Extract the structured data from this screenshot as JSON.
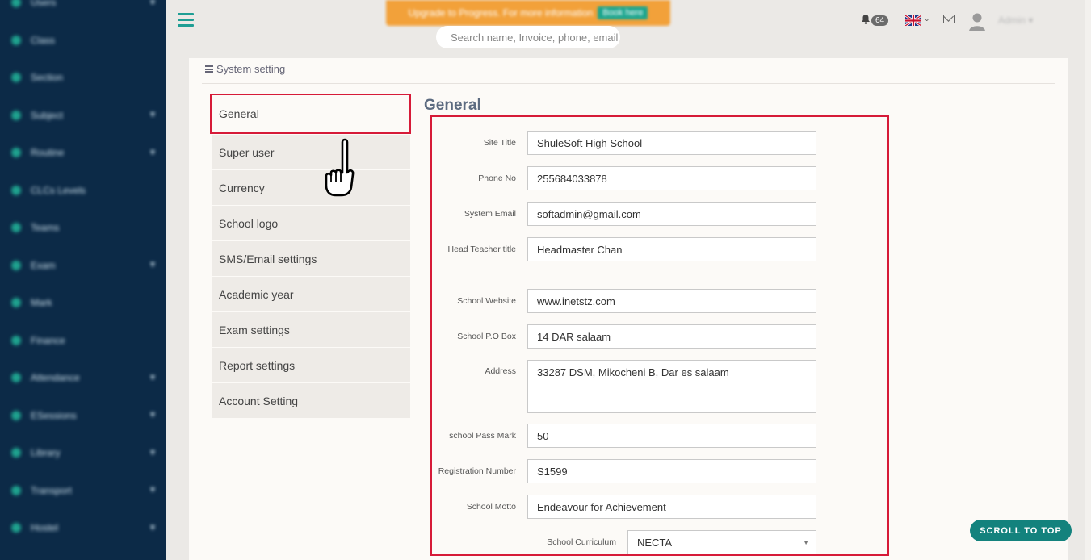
{
  "topbar": {
    "promo_text": "Upgrade to Progress. For more information",
    "promo_button": "Book here",
    "search_placeholder": "Search name, Invoice, phone, email",
    "notification_count": "64",
    "user_name": "Admin",
    "user_caret": "▾"
  },
  "sidebar": {
    "items": [
      {
        "label": "Users",
        "icon": "users-icon",
        "has_caret": true
      },
      {
        "label": "Class",
        "icon": "class-icon",
        "has_caret": false
      },
      {
        "label": "Section",
        "icon": "section-icon",
        "has_caret": false
      },
      {
        "label": "Subject",
        "icon": "subject-icon",
        "has_caret": true
      },
      {
        "label": "Routine",
        "icon": "routine-icon",
        "has_caret": true
      },
      {
        "label": "CLCs Levels",
        "icon": "levels-icon",
        "has_caret": false
      },
      {
        "label": "Teams",
        "icon": "teams-icon",
        "has_caret": false
      },
      {
        "label": "Exam",
        "icon": "exam-icon",
        "has_caret": true
      },
      {
        "label": "Mark",
        "icon": "mark-icon",
        "has_caret": false
      },
      {
        "label": "Finance",
        "icon": "finance-icon",
        "has_caret": false
      },
      {
        "label": "Attendance",
        "icon": "attendance-icon",
        "has_caret": true
      },
      {
        "label": "ESessions",
        "icon": "sessions-icon",
        "has_caret": true
      },
      {
        "label": "Library",
        "icon": "library-icon",
        "has_caret": true
      },
      {
        "label": "Transport",
        "icon": "transport-icon",
        "has_caret": true
      },
      {
        "label": "Hostel",
        "icon": "hostel-icon",
        "has_caret": true
      }
    ]
  },
  "breadcrumb": "System setting",
  "settings_menu": [
    {
      "label": "General"
    },
    {
      "label": "Super user"
    },
    {
      "label": "Currency"
    },
    {
      "label": "School logo"
    },
    {
      "label": "SMS/Email settings"
    },
    {
      "label": "Academic year"
    },
    {
      "label": "Exam settings"
    },
    {
      "label": "Report settings"
    },
    {
      "label": "Account Setting"
    }
  ],
  "section_title": "General",
  "form": {
    "site_title": {
      "label": "Site Title",
      "value": "ShuleSoft High School"
    },
    "phone_no": {
      "label": "Phone No",
      "value": "255684033878"
    },
    "system_email": {
      "label": "System Email",
      "value": "softadmin@gmail.com"
    },
    "head_teacher_title": {
      "label": "Head Teacher title",
      "value": "Headmaster Chan"
    },
    "school_website": {
      "label": "School Website",
      "value": "www.inetstz.com"
    },
    "school_po_box": {
      "label": "School P.O Box",
      "value": "14 DAR salaam"
    },
    "address": {
      "label": "Address",
      "value": "33287 DSM, Mikocheni B, Dar es salaam"
    },
    "school_pass_mark": {
      "label": "school Pass Mark",
      "value": "50"
    },
    "registration_number": {
      "label": "Registration Number",
      "value": "S1599"
    },
    "school_motto": {
      "label": "School Motto",
      "value": "Endeavour for Achievement"
    },
    "school_curriculum": {
      "label": "School Curriculum",
      "value": "NECTA"
    }
  },
  "scroll_to_top": "SCROLL TO TOP",
  "colors": {
    "sidebar_bg": "#0c2a47",
    "accent_teal": "#1f9e94",
    "highlight_red": "#d61a38",
    "promo_orange": "#f2a13a"
  }
}
